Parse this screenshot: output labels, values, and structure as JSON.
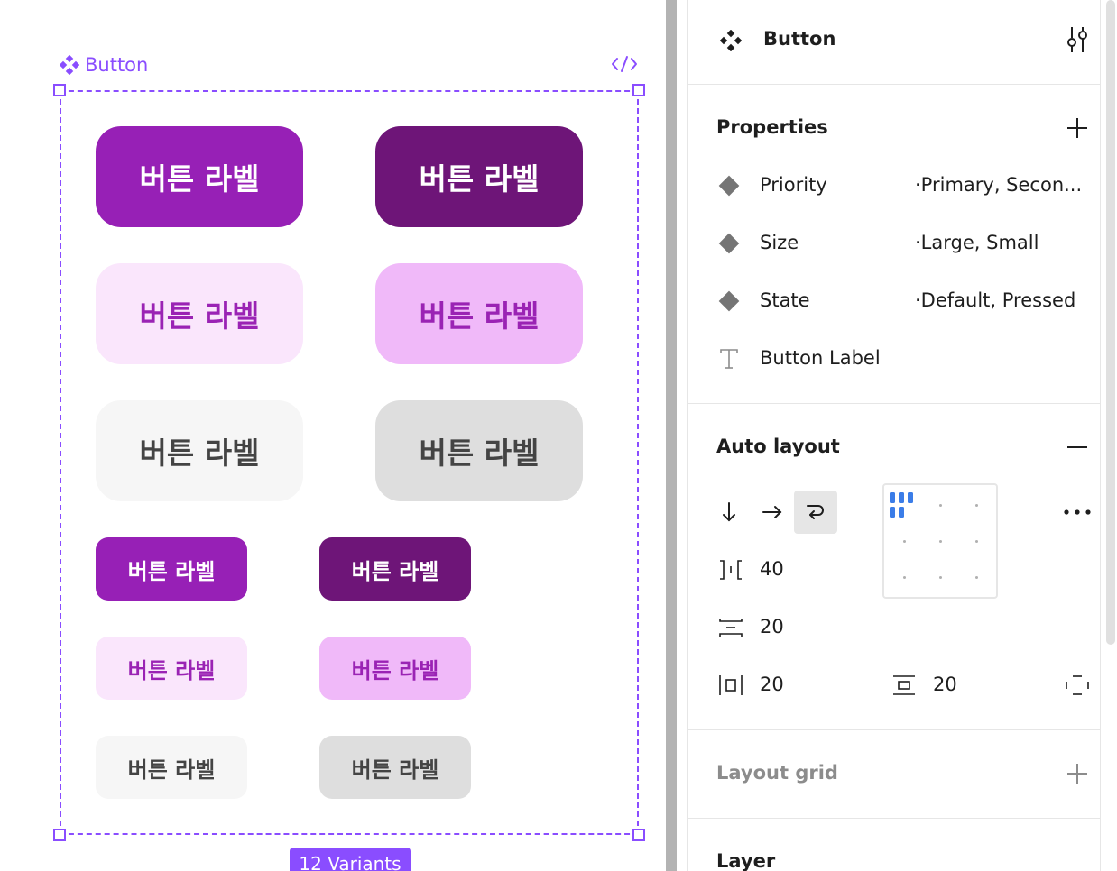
{
  "canvas": {
    "frame_label": "Button",
    "variants_badge": "12 Variants",
    "button_label": "버튼 라벨"
  },
  "panel": {
    "title": "Button",
    "properties": {
      "header": "Properties",
      "items": [
        {
          "name": "Priority",
          "value": "·Primary, Secon..."
        },
        {
          "name": "Size",
          "value": "·Large, Small"
        },
        {
          "name": "State",
          "value": "·Default, Pressed"
        },
        {
          "name": "Button Label"
        }
      ]
    },
    "auto_layout": {
      "header": "Auto layout",
      "gap": "40",
      "vertical_gap": "20",
      "padding_horizontal": "20",
      "padding_vertical": "20"
    },
    "layout_grid": {
      "header": "Layout grid"
    },
    "layer": {
      "header": "Layer"
    }
  },
  "colors": {
    "selection": "#8a4dff",
    "primary_default": "#9720b6",
    "primary_pressed": "#6e1578",
    "secondary_default": "#fae6fc",
    "secondary_pressed": "#f0b9f9",
    "tertiary_default": "#f6f6f6",
    "tertiary_pressed": "#dedede",
    "alignment_active": "#3b7de8"
  },
  "icons": [
    "component-icon",
    "code-icon",
    "adjust-icon",
    "plus-icon",
    "minus-icon",
    "variant-property-icon",
    "text-property-icon",
    "arrow-down-icon",
    "arrow-right-icon",
    "wrap-icon",
    "more-icon",
    "spacing-icon",
    "padding-icon"
  ]
}
